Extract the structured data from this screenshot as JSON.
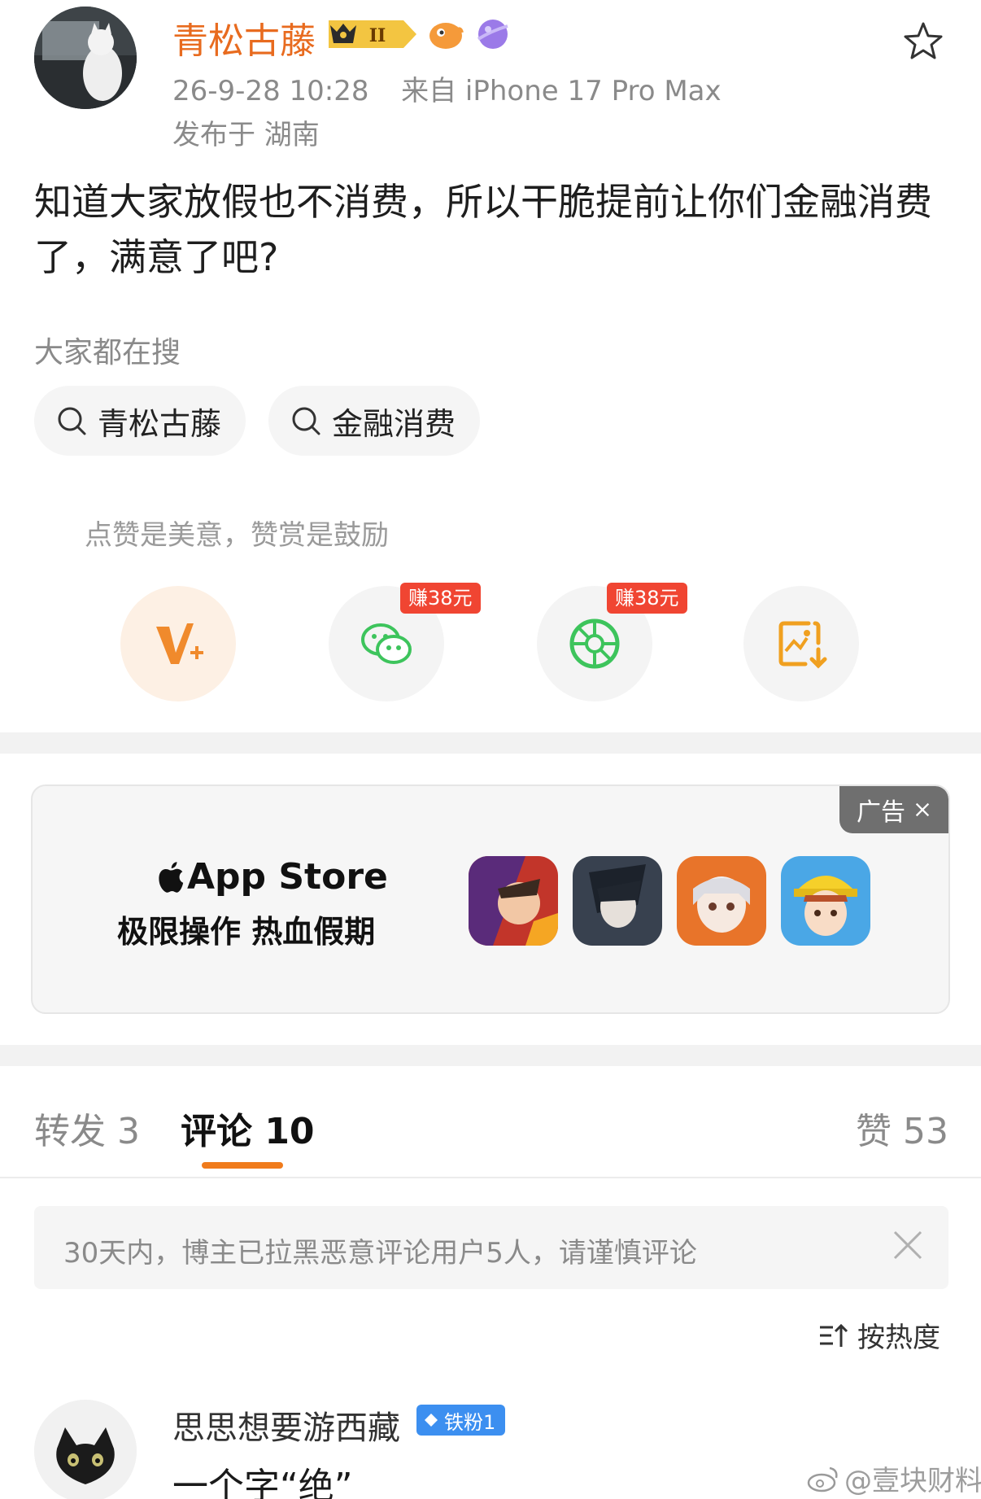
{
  "post": {
    "username": "青松古藤",
    "vip_label": "II",
    "timestamp": "26-9-28 10:28",
    "source": "来自 iPhone 17 Pro Max",
    "location": "发布于 湖南",
    "text": "知道大家放假也不消费，所以干脆提前让你们金融消费了，满意了吧?"
  },
  "search": {
    "title": "大家都在搜",
    "chips": [
      "青松古藤",
      "金融消费"
    ]
  },
  "actions": {
    "tip": "点赞是美意，赞赏是鼓励",
    "earn_badges": [
      "赚38元",
      "赚38元"
    ]
  },
  "ad": {
    "tag": "广告",
    "logo_text": "App Store",
    "slogan": "极限操作 热血假期"
  },
  "tabs": {
    "repost": "转发 3",
    "comments": "评论 10",
    "likes": "赞 53"
  },
  "notice": {
    "text": "30天内，博主已拉黑恶意评论用户5人，请谨慎评论"
  },
  "sort": {
    "label": "按热度"
  },
  "comment": {
    "username": "思思想要游西藏",
    "badge": "铁粉1",
    "text": "一个字“绝”"
  },
  "watermark": {
    "text": "@壹块财料"
  },
  "colors": {
    "brand_orange": "#e86b1f",
    "tab_underline": "#f07b1c",
    "earn_red": "#f04532",
    "wechat_green": "#3dc45c",
    "fan_badge_blue": "#3c8ff0"
  }
}
